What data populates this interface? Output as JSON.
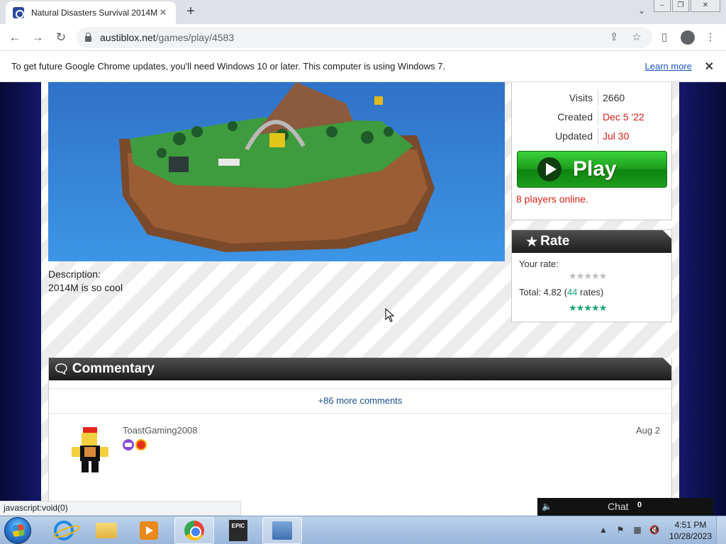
{
  "browser": {
    "tab_title": "Natural Disasters Survival 2014M",
    "tab_close": "✕",
    "new_tab": "+",
    "url_host": "austiblox.net",
    "url_path": "/games/play/4583",
    "icons": [
      "back-icon",
      "forward-icon",
      "reload-icon",
      "lock-icon",
      "share-icon",
      "star-icon",
      "side-panel-icon",
      "profile-icon",
      "menu-icon"
    ]
  },
  "infobar": {
    "message": "To get future Google Chrome updates, you'll need Windows 10 or later. This computer is using Windows 7.",
    "link": "Learn more",
    "close": "✕"
  },
  "game": {
    "description_label": "Description:",
    "description": "2014M is so cool",
    "info": {
      "visits_label": "Visits",
      "visits": "2660",
      "created_label": "Created",
      "created": "Dec 5 '22",
      "updated_label": "Updated",
      "updated": "Jul 30"
    },
    "play_label": "Play",
    "players_online": "8 players online."
  },
  "rate": {
    "title": "Rate",
    "your_rate_label": "Your rate:",
    "your_rate_stars": 0,
    "total_prefix": "Total: 4.82 (",
    "total_count": "44",
    "total_suffix": " rates)",
    "total_stars": 5
  },
  "commentary": {
    "title": "Commentary",
    "more_comments": "+86 more comments",
    "comments": [
      {
        "user": "ToastGaming2008",
        "date": "Aug 2"
      }
    ]
  },
  "status_text": "javascript:void(0)",
  "chat": {
    "label": "Chat",
    "count": "0"
  },
  "taskbar": {
    "apps": [
      "internet-explorer",
      "file-explorer",
      "media-player",
      "google-chrome",
      "epic-games",
      "network-app"
    ],
    "time": "4:51 PM",
    "date": "10/28/2023"
  },
  "colors": {
    "accent_red": "#d9201b",
    "play_green": "#1d9f1d",
    "rate_teal": "#16a67a",
    "page_bg": "#0b0f3f"
  }
}
